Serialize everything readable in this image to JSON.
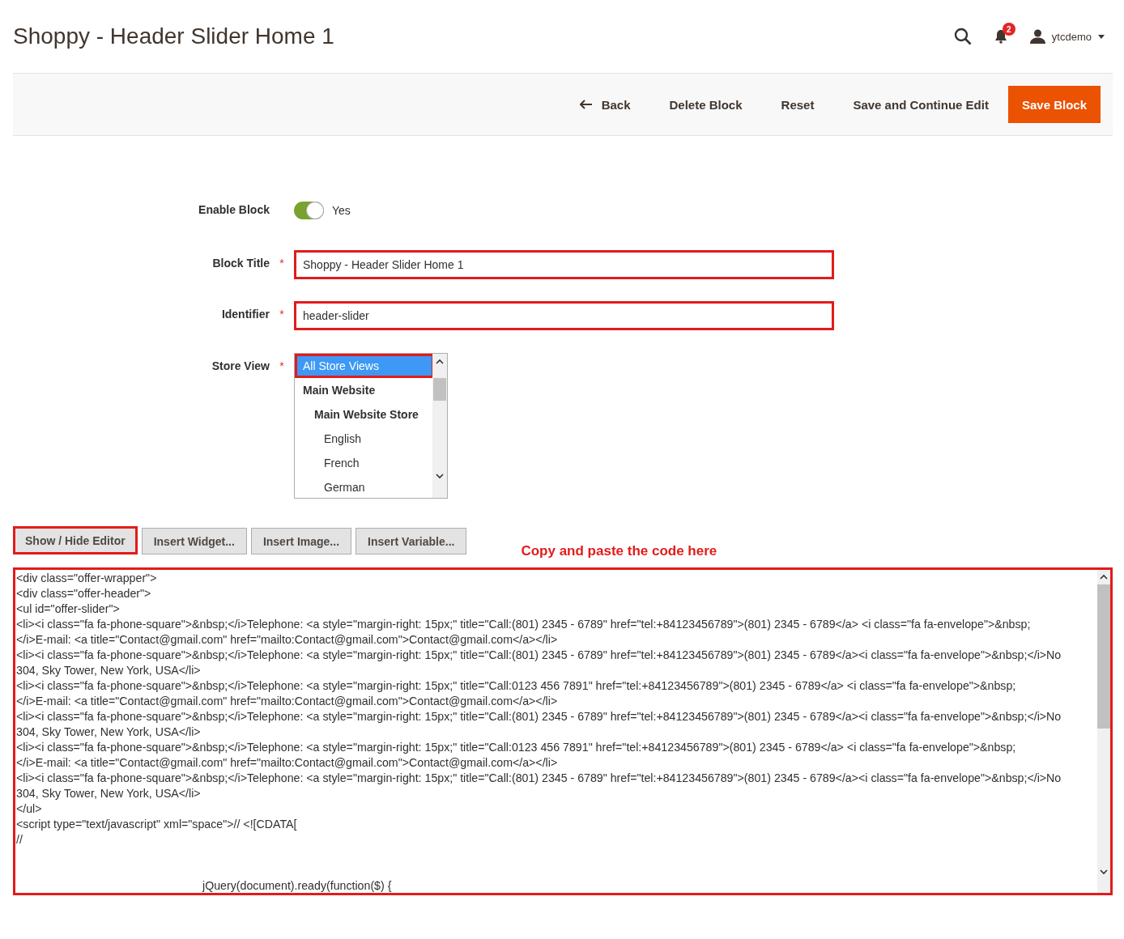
{
  "page_title": "Shoppy - Header Slider Home 1",
  "header": {
    "notifications": "2",
    "user": "ytcdemo"
  },
  "actions": [
    {
      "label": "Back",
      "kind": "back"
    },
    {
      "label": "Delete Block",
      "kind": "plain"
    },
    {
      "label": "Reset",
      "kind": "plain"
    },
    {
      "label": "Save and Continue Edit",
      "kind": "plain"
    },
    {
      "label": "Save Block",
      "kind": "primary"
    }
  ],
  "form": {
    "enable_block": {
      "label": "Enable Block",
      "on": true,
      "value": "Yes"
    },
    "block_title": {
      "label": "Block Title",
      "required_mark": "*",
      "value": "Shoppy - Header Slider Home 1",
      "highlighted": true
    },
    "identifier": {
      "label": "Identifier",
      "required_mark": "*",
      "value": "header-slider",
      "highlighted": true
    },
    "store_view": {
      "label": "Store View",
      "required_mark": "*",
      "options": [
        {
          "label": "All Store Views",
          "kind": "option",
          "selected": true,
          "highlighted": true
        },
        {
          "label": "Main Website",
          "kind": "group",
          "selected": false,
          "children": [
            {
              "label": "Main Website Store",
              "kind": "group",
              "selected": false,
              "children": [
                {
                  "label": "English",
                  "kind": "option",
                  "selected": false
                },
                {
                  "label": "French",
                  "kind": "option",
                  "selected": false
                },
                {
                  "label": "German",
                  "kind": "option",
                  "selected": false
                }
              ]
            }
          ]
        }
      ]
    }
  },
  "editor_buttons": [
    {
      "label": "Show / Hide Editor",
      "highlighted": true
    },
    {
      "label": "Insert Widget...",
      "highlighted": false
    },
    {
      "label": "Insert Image...",
      "highlighted": false
    },
    {
      "label": "Insert Variable...",
      "highlighted": false
    }
  ],
  "annotation": "Copy and paste the code here",
  "editor": {
    "highlighted": true,
    "lines": [
      {
        "text": "<div class=\"offer-wrapper\">",
        "kind": "plain"
      },
      {
        "text": "<div class=\"offer-header\">",
        "kind": "plain"
      },
      {
        "text": "<ul id=\"offer-slider\">",
        "kind": "plain"
      },
      {
        "text": "<li><i class=\"fa fa-phone-square\">&nbsp;</i>Telephone: <a style=\"margin-right: 15px;\" title=\"Call:(801) 2345 - 6789\" href=\"tel:+84123456789\">(801) 2345 - 6789</a> <i class=\"fa fa-envelope\">&nbsp;",
        "kind": "plain"
      },
      {
        "text": "</i>E-mail: <a title=\"Contact@gmail.com\" href=\"mailto:Contact@gmail.com\">Contact@gmail.com</a></li>",
        "kind": "plain"
      },
      {
        "text": "<li><i class=\"fa fa-phone-square\">&nbsp;</i>Telephone: <a style=\"margin-right: 15px;\" title=\"Call:(801) 2345 - 6789\" href=\"tel:+84123456789\">(801) 2345 - 6789</a><i class=\"fa fa-envelope\">&nbsp;</i>No",
        "kind": "plain"
      },
      {
        "text": "304, Sky Tower, New York, USA</li>",
        "kind": "plain"
      },
      {
        "text": "<li><i class=\"fa fa-phone-square\">&nbsp;</i>Telephone: <a style=\"margin-right: 15px;\" title=\"Call:0123 456 7891\" href=\"tel:+84123456789\">(801) 2345 - 6789</a> <i class=\"fa fa-envelope\">&nbsp;",
        "kind": "plain"
      },
      {
        "text": "</i>E-mail: <a title=\"Contact@gmail.com\" href=\"mailto:Contact@gmail.com\">Contact@gmail.com</a></li>",
        "kind": "plain"
      },
      {
        "text": "<li><i class=\"fa fa-phone-square\">&nbsp;</i>Telephone: <a style=\"margin-right: 15px;\" title=\"Call:(801) 2345 - 6789\" href=\"tel:+84123456789\">(801) 2345 - 6789</a><i class=\"fa fa-envelope\">&nbsp;</i>No",
        "kind": "plain"
      },
      {
        "text": "304, Sky Tower, New York, USA</li>",
        "kind": "plain"
      },
      {
        "text": "<li><i class=\"fa fa-phone-square\">&nbsp;</i>Telephone: <a style=\"margin-right: 15px;\" title=\"Call:0123 456 7891\" href=\"tel:+84123456789\">(801) 2345 - 6789</a> <i class=\"fa fa-envelope\">&nbsp;",
        "kind": "plain"
      },
      {
        "text": "</i>E-mail: <a title=\"Contact@gmail.com\" href=\"mailto:Contact@gmail.com\">Contact@gmail.com</a></li>",
        "kind": "plain"
      },
      {
        "text": "<li><i class=\"fa fa-phone-square\">&nbsp;</i>Telephone: <a style=\"margin-right: 15px;\" title=\"Call:(801) 2345 - 6789\" href=\"tel:+84123456789\">(801) 2345 - 6789</a><i class=\"fa fa-envelope\">&nbsp;</i>No",
        "kind": "plain"
      },
      {
        "text": "304, Sky Tower, New York, USA</li>",
        "kind": "plain"
      },
      {
        "text": "</ul>",
        "kind": "plain"
      },
      {
        "text": "<script type=\"text/javascript\" xml=\"space\">// <![CDATA[",
        "kind": "plain"
      },
      {
        "text": "//",
        "kind": "plain"
      },
      {
        "text": "jQuery(document).ready(function($) {",
        "kind": "indented"
      }
    ]
  }
}
